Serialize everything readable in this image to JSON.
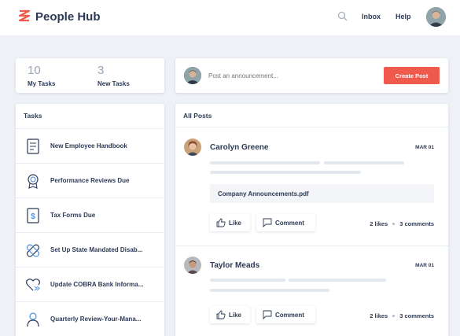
{
  "header": {
    "brand": "People Hub",
    "nav": {
      "inbox": "Inbox",
      "help": "Help"
    },
    "colors": {
      "brand_accent": "#ef5a4c"
    }
  },
  "stats": [
    {
      "value": "10",
      "label": "My Tasks"
    },
    {
      "value": "3",
      "label": "New Tasks"
    }
  ],
  "announcement": {
    "placeholder": "Post an announcement...",
    "button": "Create Post"
  },
  "tasks": {
    "heading": "Tasks",
    "items": [
      {
        "label": "New Employee Handbook",
        "icon": "document-list-icon"
      },
      {
        "label": "Performance Reviews Due",
        "icon": "award-badge-icon"
      },
      {
        "label": "Tax Forms Due",
        "icon": "dollar-document-icon"
      },
      {
        "label": "Set Up State Mandated Disab...",
        "icon": "bandage-icon"
      },
      {
        "label": "Update COBRA Bank Informa...",
        "icon": "heart-transfer-icon"
      },
      {
        "label": "Quarterly Review-Your-Mana...",
        "icon": "person-icon"
      }
    ]
  },
  "posts": {
    "heading": "All Posts",
    "items": [
      {
        "author": "Carolyn Greene",
        "date": "MAR 01",
        "attachment": "Company Announcements.pdf",
        "like_label": "Like",
        "comment_label": "Comment",
        "likes": "2 likes",
        "comments": "3 comments"
      },
      {
        "author": "Taylor Meads",
        "date": "MAR 01",
        "like_label": "Like",
        "comment_label": "Comment",
        "likes": "2 likes",
        "comments": "3 comments"
      }
    ]
  }
}
